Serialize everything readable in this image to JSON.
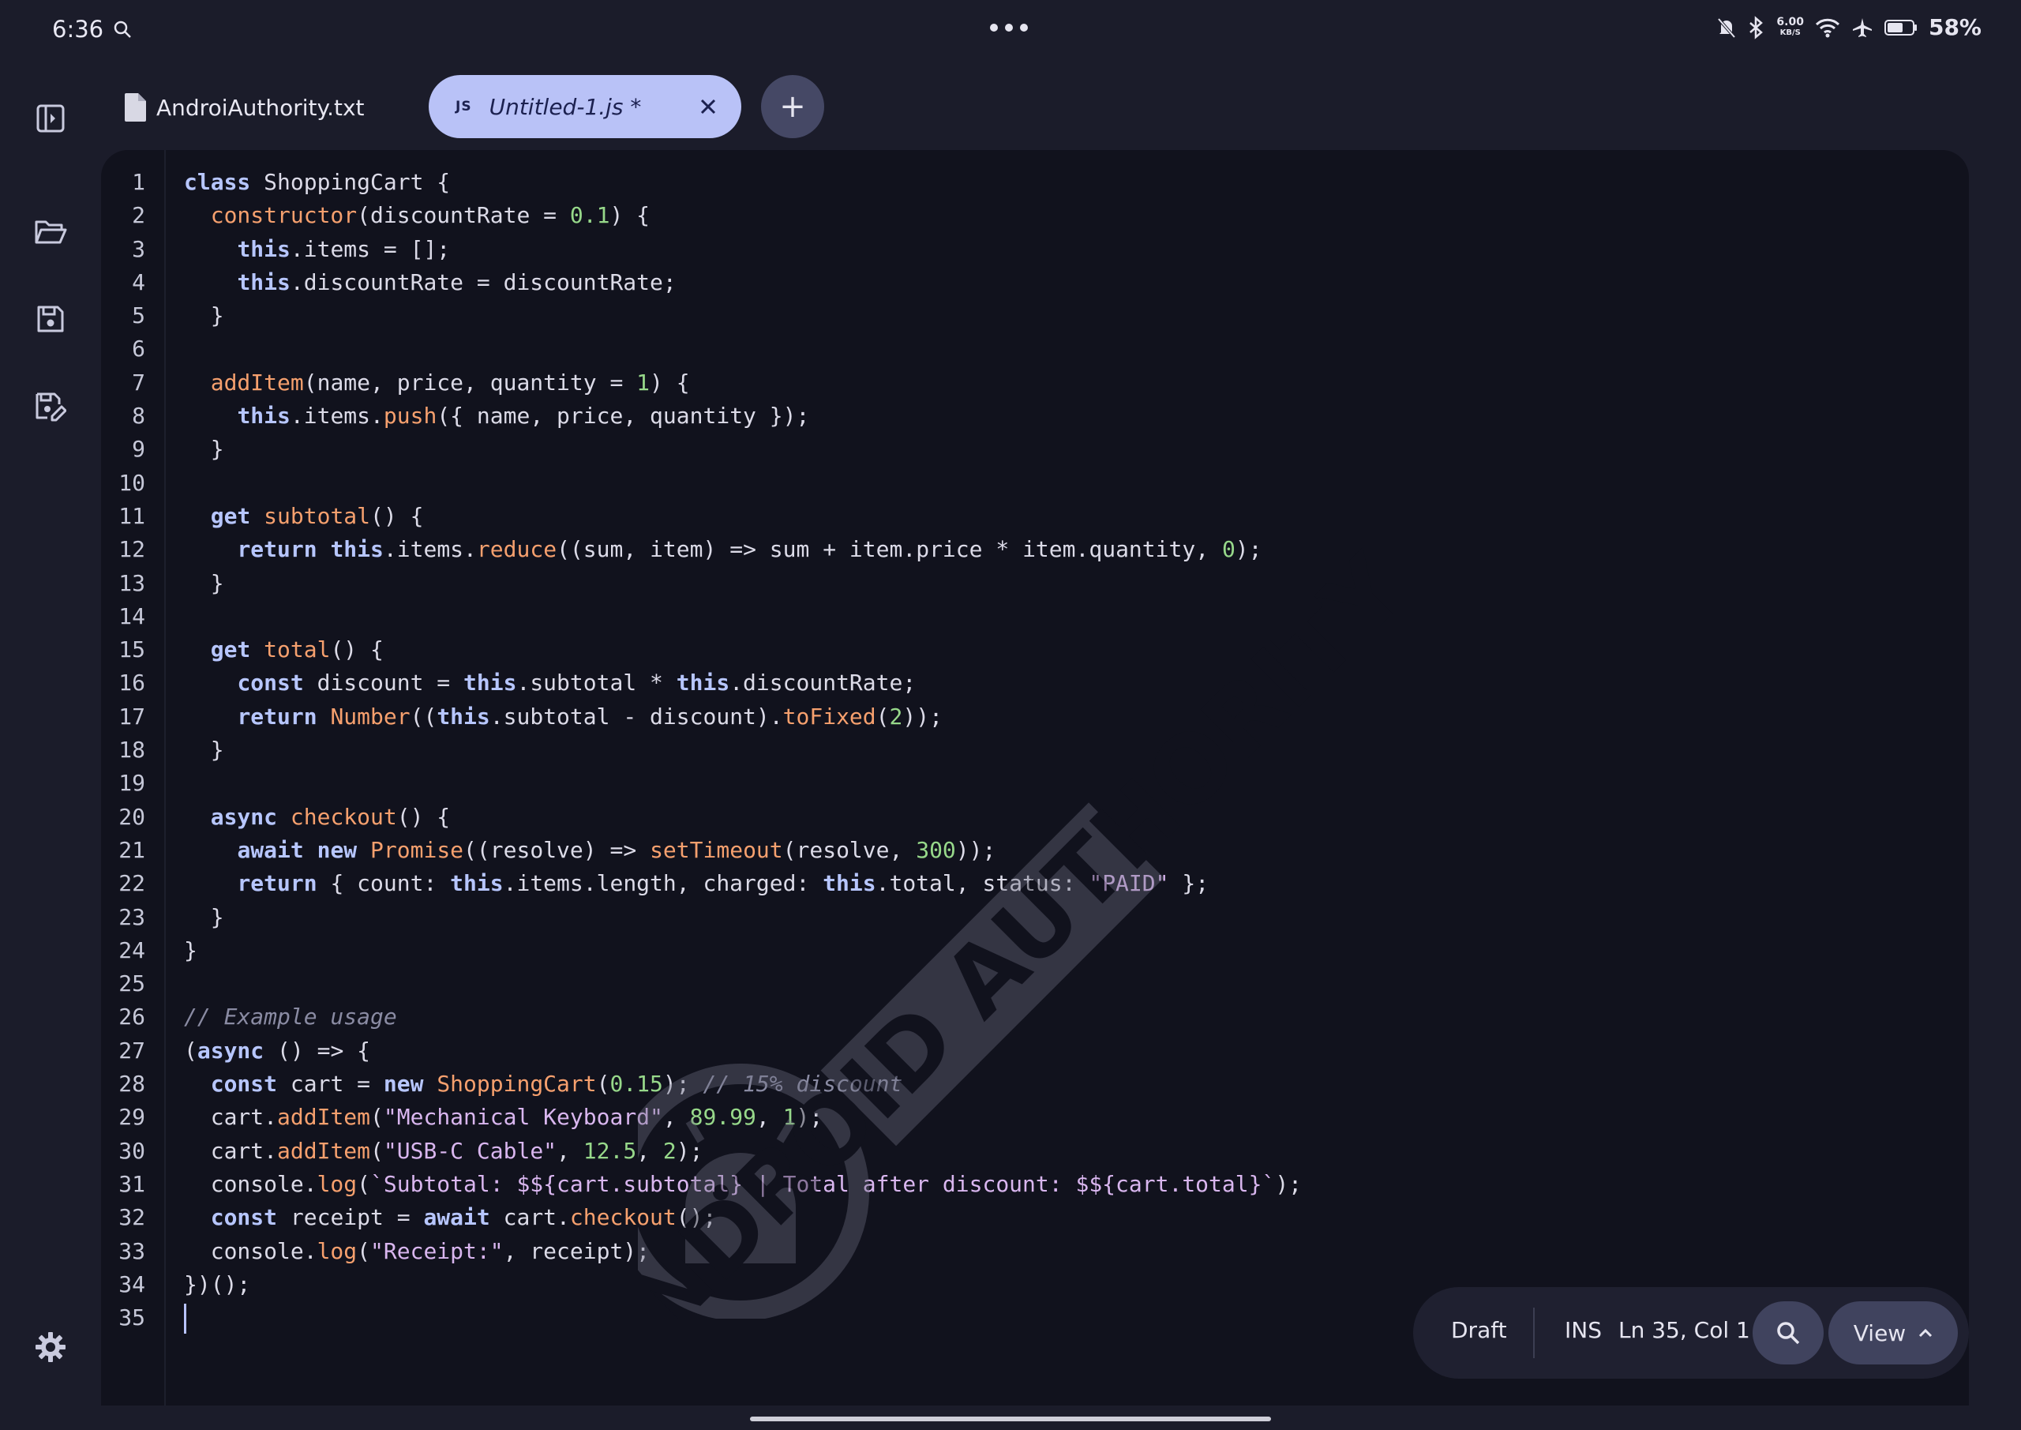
{
  "status_bar": {
    "time": "6:36",
    "net_speed": "6.00",
    "net_speed_unit": "KB/S",
    "battery": "58%",
    "icons": [
      "search-icon",
      "more-dots-icon",
      "mute-icon",
      "bluetooth-icon",
      "wifi-icon",
      "airplane-icon",
      "battery-icon"
    ]
  },
  "sidebar": {
    "items": [
      {
        "name": "toggle-sidebar-icon"
      },
      {
        "name": "open-folder-icon"
      },
      {
        "name": "save-icon"
      },
      {
        "name": "save-as-icon"
      },
      {
        "name": "settings-icon"
      }
    ]
  },
  "tabs": {
    "file_tab_label": "AndroiAuthority.txt",
    "active_tab_badge": "JS",
    "active_tab_label": "Untitled-1.js *",
    "add_tab": "+"
  },
  "editor": {
    "lines": [
      "class ShoppingCart {",
      "  constructor(discountRate = 0.1) {",
      "    this.items = [];",
      "    this.discountRate = discountRate;",
      "  }",
      "",
      "  addItem(name, price, quantity = 1) {",
      "    this.items.push({ name, price, quantity });",
      "  }",
      "",
      "  get subtotal() {",
      "    return this.items.reduce((sum, item) => sum + item.price * item.quantity, 0);",
      "  }",
      "",
      "  get total() {",
      "    const discount = this.subtotal * this.discountRate;",
      "    return Number((this.subtotal - discount).toFixed(2));",
      "  }",
      "",
      "  async checkout() {",
      "    await new Promise((resolve) => setTimeout(resolve, 300));",
      "    return { count: this.items.length, charged: this.total, status: \"PAID\" };",
      "  }",
      "}",
      "",
      "// Example usage",
      "(async () => {",
      "  const cart = new ShoppingCart(0.15); // 15% discount",
      "  cart.addItem(\"Mechanical Keyboard\", 89.99, 1);",
      "  cart.addItem(\"USB-C Cable\", 12.5, 2);",
      "  console.log(`Subtotal: $${cart.subtotal} | Total after discount: $${cart.total}`);",
      "  const receipt = await cart.checkout();",
      "  console.log(\"Receipt:\", receipt);",
      "})();",
      ""
    ],
    "cursor_line": 35
  },
  "status": {
    "mode": "Draft",
    "insert_mode": "INS",
    "position": "Ln 35, Col 1",
    "view_label": "View"
  },
  "watermark": {
    "text": "ANDROID AUTHORITY"
  },
  "colors": {
    "background": "#1b1c2a",
    "editor_bg": "#11121d",
    "active_tab": "#b9c2f7",
    "keyword": "#b7c6ff",
    "function": "#f6a06e",
    "number": "#97d88a",
    "string": "#d9b6ef",
    "comment": "#8a8ba3"
  }
}
